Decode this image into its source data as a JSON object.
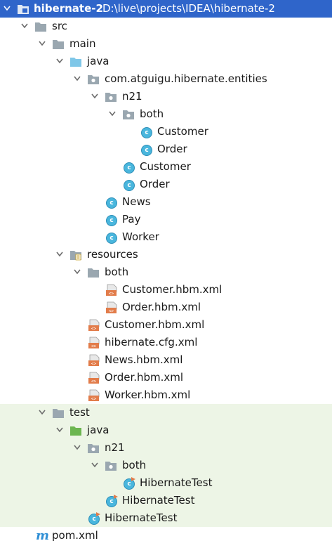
{
  "project": {
    "name": "hibernate-2",
    "path": "D:\\live\\projects\\IDEA\\hibernate-2"
  },
  "nodes": {
    "src": "src",
    "main": "main",
    "main_java": "java",
    "pkg_entities": "com.atguigu.hibernate.entities",
    "pkg_n21": "n21",
    "pkg_both": "both",
    "both_customer": "Customer",
    "both_order": "Order",
    "n21_customer": "Customer",
    "n21_order": "Order",
    "news": "News",
    "pay": "Pay",
    "worker": "Worker",
    "resources": "resources",
    "res_both": "both",
    "res_both_customer_xml": "Customer.hbm.xml",
    "res_both_order_xml": "Order.hbm.xml",
    "customer_xml": "Customer.hbm.xml",
    "hibernate_cfg": "hibernate.cfg.xml",
    "news_xml": "News.hbm.xml",
    "order_xml": "Order.hbm.xml",
    "worker_xml": "Worker.hbm.xml",
    "test": "test",
    "test_java": "java",
    "test_n21": "n21",
    "test_both": "both",
    "test_both_hibernatetest": "HibernateTest",
    "test_n21_hibernatetest": "HibernateTest",
    "test_hibernatetest": "HibernateTest",
    "pom": "pom.xml"
  },
  "icons": {
    "class_letter": "c",
    "maven_letter": "m"
  },
  "colors": {
    "selection": "#2f65ca",
    "test_background": "#edf5e6",
    "folder_gray": "#9aa7b0",
    "source_folder_blue": "#7fc7e8",
    "test_folder_green": "#6cb650",
    "class_icon": "#49b6dd",
    "xml_orange": "#e27c4a"
  }
}
